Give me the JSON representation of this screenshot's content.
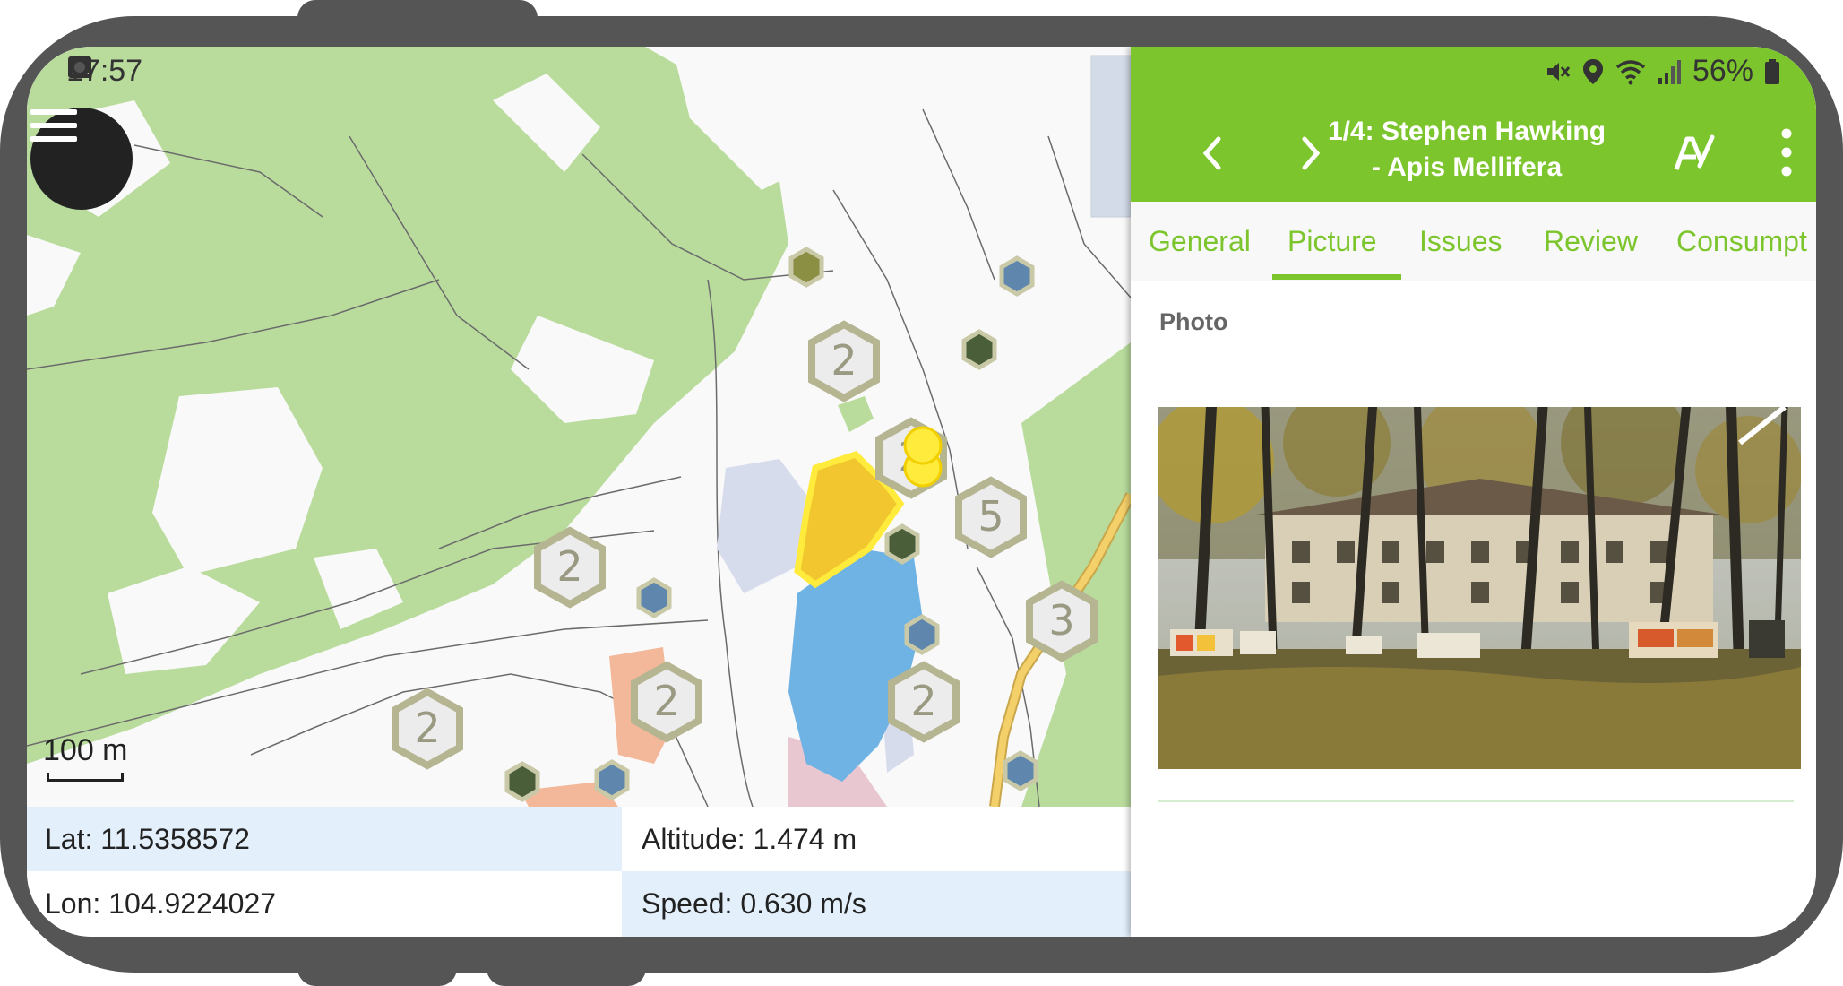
{
  "status": {
    "time": "17:57",
    "battery": "56%"
  },
  "map": {
    "scale_label": "100 m",
    "cluster_counts": [
      "2",
      "2",
      "2",
      "5",
      "2",
      "2",
      "3",
      "2"
    ],
    "cluster_partial_label": "2"
  },
  "info": {
    "lat": "Lat: 11.5358572",
    "lon": "Lon: 104.9224027",
    "altitude": "Altitude: 1.474 m",
    "speed": "Speed: 0.630 m/s"
  },
  "panel": {
    "title_line1": "1/4: Stephen Hawking",
    "title_line2": "- Apis Mellifera",
    "tabs": [
      "General",
      "Picture",
      "Issues",
      "Review",
      "Consumpt"
    ],
    "active_tab": "Picture",
    "section_label": "Photo"
  },
  "colors": {
    "accent": "#7cc52d",
    "info_blue": "#e3f0fc",
    "forest": "#b9dc9d",
    "water": "#6fb3e4",
    "selected": "#ffeb3b"
  },
  "icons": [
    "menu-icon",
    "image-icon",
    "sync-icon",
    "mute-icon",
    "location-icon",
    "wifi-icon",
    "signal-icon",
    "battery-icon",
    "chevron-left-icon",
    "chevron-right-icon",
    "edit-text-icon",
    "more-vert-icon",
    "edit-pen-icon"
  ]
}
